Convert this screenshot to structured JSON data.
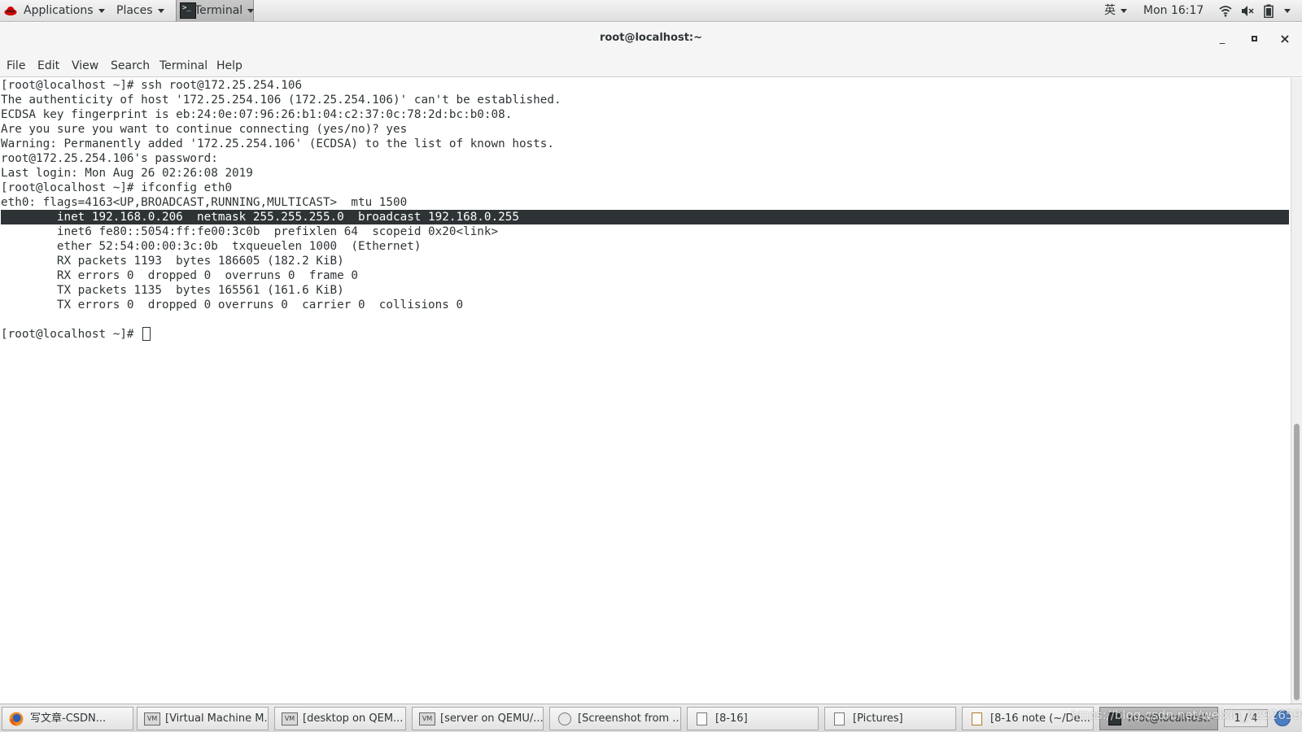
{
  "top_panel": {
    "applications": "Applications",
    "places": "Places",
    "terminal_task": "Terminal",
    "input_method": "英",
    "clock": "Mon 16:17"
  },
  "window": {
    "title": "root@localhost:~",
    "minimize": "_",
    "maximize": "▫",
    "close": "×"
  },
  "menu": [
    "File",
    "Edit",
    "View",
    "Search",
    "Terminal",
    "Help"
  ],
  "terminal": {
    "lines": [
      "[root@localhost ~]# ssh root@172.25.254.106",
      "The authenticity of host '172.25.254.106 (172.25.254.106)' can't be established.",
      "ECDSA key fingerprint is eb:24:0e:07:96:26:b1:04:c2:37:0c:78:2d:bc:b0:08.",
      "Are you sure you want to continue connecting (yes/no)? yes",
      "Warning: Permanently added '172.25.254.106' (ECDSA) to the list of known hosts.",
      "root@172.25.254.106's password:",
      "Last login: Mon Aug 26 02:26:08 2019",
      "[root@localhost ~]# ifconfig eth0",
      "eth0: flags=4163<UP,BROADCAST,RUNNING,MULTICAST>  mtu 1500",
      "        inet 192.168.0.206  netmask 255.255.255.0  broadcast 192.168.0.255",
      "        inet6 fe80::5054:ff:fe00:3c0b  prefixlen 64  scopeid 0x20<link>",
      "        ether 52:54:00:00:3c:0b  txqueuelen 1000  (Ethernet)",
      "        RX packets 1193  bytes 186605 (182.2 KiB)",
      "        RX errors 0  dropped 0  overruns 0  frame 0",
      "        TX packets 1135  bytes 165561 (161.6 KiB)",
      "        TX errors 0  dropped 0 overruns 0  carrier 0  collisions 0",
      "",
      "[root@localhost ~]# "
    ],
    "selected_line_index": 9
  },
  "taskbar": {
    "tasks": [
      {
        "label": "写文章-CSDN...",
        "icon": "firefox-icon"
      },
      {
        "label": "[Virtual Machine M...",
        "icon": "virt-manager-icon"
      },
      {
        "label": "[desktop on QEM...",
        "icon": "virt-manager-icon"
      },
      {
        "label": "[server on QEMU/...",
        "icon": "virt-manager-icon"
      },
      {
        "label": "[Screenshot from ...",
        "icon": "image-viewer-icon"
      },
      {
        "label": "[8-16]",
        "icon": "file-manager-icon"
      },
      {
        "label": "[Pictures]",
        "icon": "file-manager-icon"
      },
      {
        "label": "[8-16 note (~/De...",
        "icon": "text-editor-icon"
      },
      {
        "label": "root@localhost:~",
        "icon": "terminal-icon"
      }
    ],
    "workspace": "1 / 4",
    "watermark": "https://blog.csdn.net/weixin_42926599"
  }
}
